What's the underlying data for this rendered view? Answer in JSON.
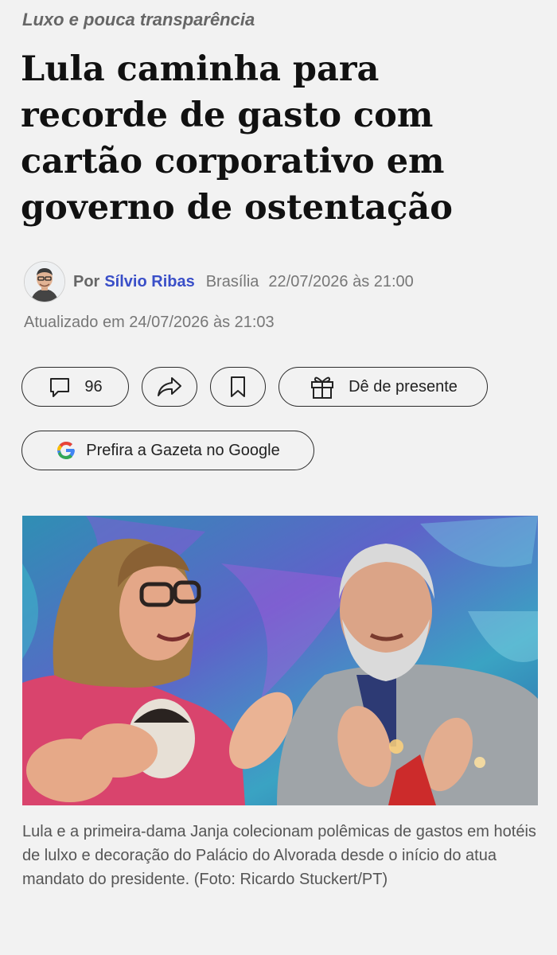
{
  "article": {
    "kicker": "Luxo e pouca transparência",
    "headline": "Lula caminha para recorde de gasto com cartão corporativo em governo de ostentação",
    "byline_prefix": "Por",
    "author": "Sílvio Ribas",
    "location": "Brasília",
    "published": "22/07/2026 às 21:00",
    "updated": "Atualizado em 24/07/2026 às 21:03",
    "caption": "Lula e a primeira-dama Janja colecionam polêmicas de gastos em hotéis de lulxo e decoração do Palácio do Alvorada desde o início do atua mandato do presidente. (Foto: Ricardo Stuckert/PT)"
  },
  "actions": {
    "comments_count": "96",
    "gift_label": "Dê de presente",
    "google_label": "Prefira a Gazeta no Google"
  },
  "icons": {
    "comments": "speech-bubble-icon",
    "share": "share-arrow-icon",
    "save": "bookmark-icon",
    "gift": "gift-icon",
    "google": "google-g-icon"
  },
  "colors": {
    "author_link": "#3a4fc8",
    "background": "#f2f2f2"
  }
}
